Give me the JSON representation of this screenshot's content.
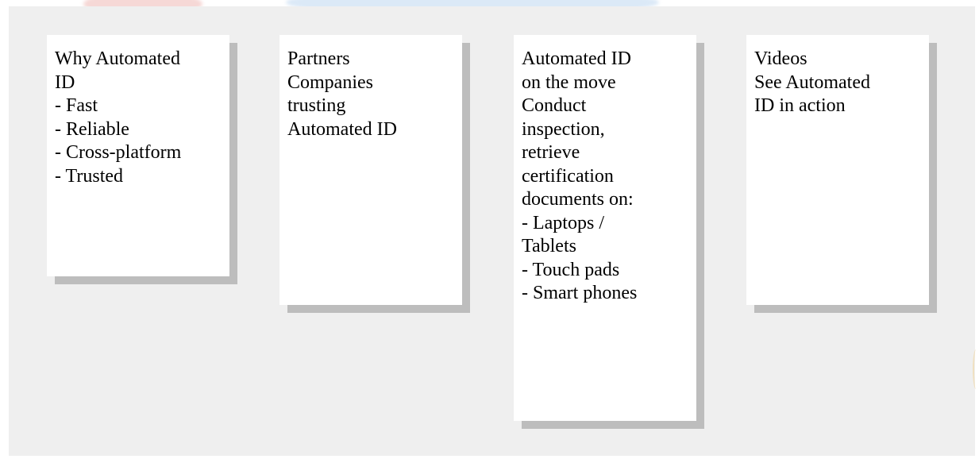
{
  "cards": [
    {
      "id": "why-automated-id",
      "lines": [
        "Why Automated",
        "ID",
        "- Fast",
        "- Reliable",
        "- Cross-platform",
        "- Trusted"
      ]
    },
    {
      "id": "partners",
      "lines": [
        "Partners",
        "Companies",
        "trusting",
        "Automated ID"
      ]
    },
    {
      "id": "on-the-move",
      "lines": [
        "Automated ID",
        "on the move",
        "Conduct",
        "inspection,",
        "retrieve",
        "certification",
        "documents on:",
        "- Laptops /",
        "Tablets",
        "- Touch pads",
        "- Smart phones"
      ]
    },
    {
      "id": "videos",
      "lines": [
        "Videos",
        "See Automated",
        "ID in action"
      ]
    }
  ],
  "colors": {
    "panel_background": "#efefef",
    "card_background": "#ffffff",
    "card_shadow": "#bdbdbd",
    "text": "#000000"
  }
}
